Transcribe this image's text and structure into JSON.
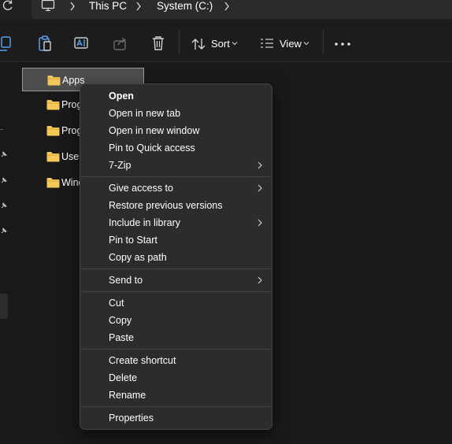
{
  "breadcrumb": {
    "items": [
      "This PC",
      "System (C:)"
    ],
    "root_icon": "computer-icon"
  },
  "toolbar": {
    "sort_label": "Sort",
    "view_label": "View",
    "icons": [
      "copy-icon",
      "paste-icon",
      "rename-icon",
      "share-icon",
      "delete-icon",
      "sort-icon",
      "view-icon",
      "more-icon"
    ]
  },
  "folders": [
    {
      "name": "Apps",
      "selected": true
    },
    {
      "name": "Prog",
      "selected": false
    },
    {
      "name": "Prog",
      "selected": false
    },
    {
      "name": "User",
      "selected": false
    },
    {
      "name": "Wind",
      "selected": false
    }
  ],
  "context_menu": {
    "groups": [
      [
        {
          "label": "Open",
          "bold": true
        },
        {
          "label": "Open in new tab"
        },
        {
          "label": "Open in new window"
        },
        {
          "label": "Pin to Quick access"
        },
        {
          "label": "7-Zip",
          "submenu": true
        }
      ],
      [
        {
          "label": "Give access to",
          "submenu": true
        },
        {
          "label": "Restore previous versions"
        },
        {
          "label": "Include in library",
          "submenu": true
        },
        {
          "label": "Pin to Start"
        },
        {
          "label": "Copy as path"
        }
      ],
      [
        {
          "label": "Send to",
          "submenu": true
        }
      ],
      [
        {
          "label": "Cut"
        },
        {
          "label": "Copy"
        },
        {
          "label": "Paste"
        }
      ],
      [
        {
          "label": "Create shortcut"
        },
        {
          "label": "Delete"
        },
        {
          "label": "Rename"
        }
      ],
      [
        {
          "label": "Properties"
        }
      ]
    ]
  },
  "colors": {
    "background": "#191919",
    "menu_bg": "#2c2c2c",
    "folder_yellow": "#f4c75a",
    "selection": "#4d4d4d"
  }
}
